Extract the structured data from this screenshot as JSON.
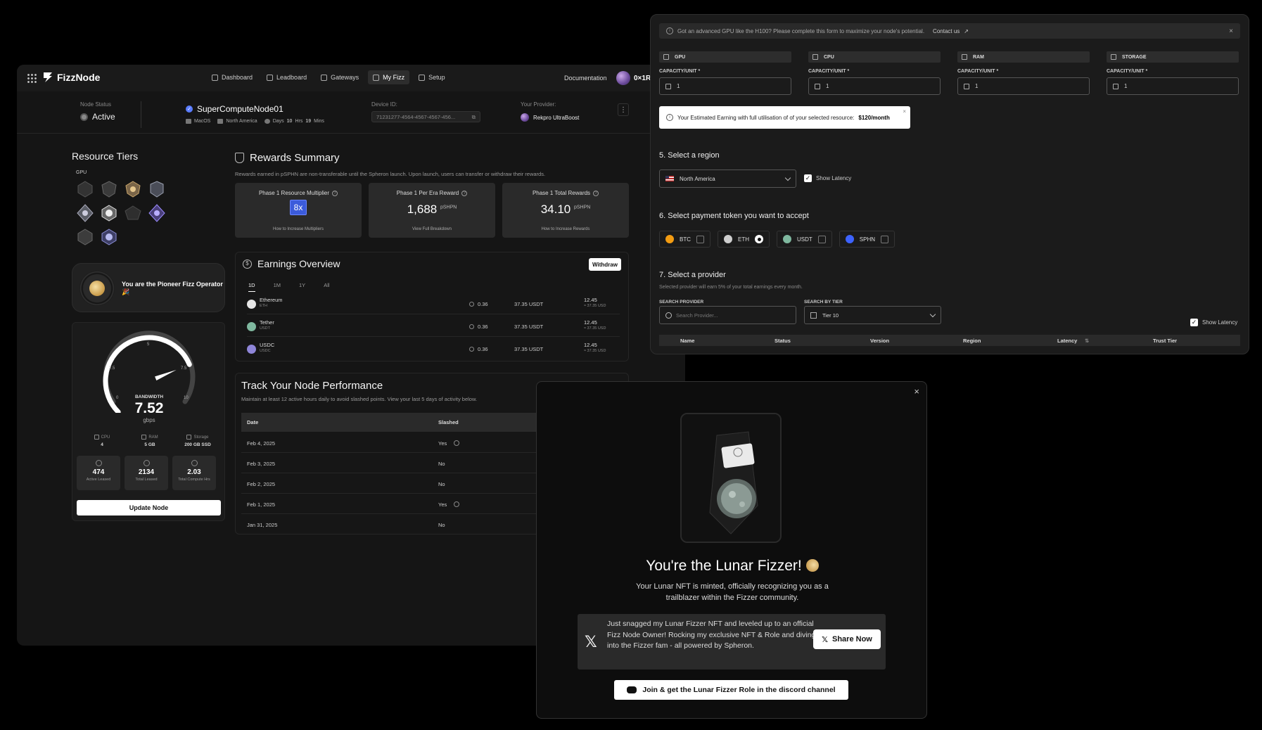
{
  "app": {
    "name": "FizzNode"
  },
  "nav": {
    "items": [
      {
        "label": "Dashboard"
      },
      {
        "label": "Leadboard"
      },
      {
        "label": "Gateways"
      },
      {
        "label": "My Fizz"
      },
      {
        "label": "Setup"
      }
    ],
    "active": "My Fizz",
    "documentation": "Documentation",
    "wallet": "0×1R..."
  },
  "status": {
    "node_status_label": "Node Status",
    "node_status": "Active",
    "node_name": "SuperComputeNode01",
    "os": "MacOS",
    "region": "North America",
    "days_prefix": "Days",
    "days": "10",
    "hrs_word": "Hrs",
    "hrs": "19",
    "mins_word": "Mins",
    "device_label": "Device ID:",
    "device_id": "71231277-4564-4567-4567-456...",
    "provider_label": "Your Provider:",
    "provider": "Rekpro UltraBoost"
  },
  "resource_tiers": {
    "title": "Resource Tiers",
    "gpu_label": "GPU",
    "pioneer_text": "You are the Pioneer Fizz Operator 🎉"
  },
  "gauge": {
    "label": "BANDWIDTH",
    "value": "7.52",
    "unit": "gbps",
    "fill_fraction": 0.75,
    "ticks": [
      "0",
      "2.5",
      "5",
      "7.5",
      "10"
    ]
  },
  "resources": [
    {
      "name": "CPU",
      "value": "4"
    },
    {
      "name": "RAM",
      "value": "5 GB"
    },
    {
      "name": "Storage",
      "value": "200 GB SSD"
    }
  ],
  "stats": [
    {
      "value": "474",
      "label": "Active Leased"
    },
    {
      "value": "2134",
      "label": "Total Leased"
    },
    {
      "value": "2.03",
      "label": "Total Compute Hrs"
    }
  ],
  "update_button": "Update Node",
  "rewards": {
    "title": "Rewards Summary",
    "subtitle": "Rewards earned in pSPHN are non-transferable until the Spheron launch. Upon launch, users can transfer or withdraw their rewards.",
    "cards": [
      {
        "title": "Phase 1 Resource Multiplier",
        "value": "8x",
        "unit": "",
        "link": "How to Increase Multipliers"
      },
      {
        "title": "Phase 1 Per Era Reward",
        "value": "1,688",
        "unit": "pSHPN",
        "link": "View Full Breakdown"
      },
      {
        "title": "Phase 1 Total Rewards",
        "value": "34.10",
        "unit": "pSHPN",
        "link": "How to Increase Rewards"
      }
    ]
  },
  "earnings": {
    "title": "Earnings Overview",
    "withdraw": "Withdraw",
    "tabs": [
      "1D",
      "1M",
      "1Y",
      "All"
    ],
    "rows": [
      {
        "name": "Ethereum",
        "symbol": "ETH",
        "amount": "0.36",
        "usdt": "37.35 USDT",
        "value": "12.45",
        "sub": "≈ 37.35 USD",
        "color": "#e6e6e6"
      },
      {
        "name": "Tether",
        "symbol": "USDT",
        "amount": "0.36",
        "usdt": "37.35 USDT",
        "value": "12.45",
        "sub": "≈ 37.35 USD",
        "color": "#7fb89f"
      },
      {
        "name": "USDC",
        "symbol": "USDC",
        "amount": "0.36",
        "usdt": "37.35 USDT",
        "value": "12.45",
        "sub": "≈ 37.35 USD",
        "color": "#8f86d9"
      }
    ]
  },
  "performance": {
    "title": "Track Your Node Performance",
    "subtitle": "Maintain at least 12 active hours daily to avoid slashed points. View your last 5 days of activity below.",
    "headers": [
      "Date",
      "Slashed"
    ],
    "rows": [
      {
        "date": "Feb 4, 2025",
        "slashed": "Yes"
      },
      {
        "date": "Feb 3, 2025",
        "slashed": "No"
      },
      {
        "date": "Feb 2, 2025",
        "slashed": "No"
      },
      {
        "date": "Feb 1, 2025",
        "slashed": "Yes"
      },
      {
        "date": "Jan 31, 2025",
        "slashed": "No"
      }
    ]
  },
  "config": {
    "info": "Got an advanced GPU like the H100? Please complete this form to maximize your node's potential.",
    "contact": "Contact us",
    "resources": [
      {
        "name": "GPU",
        "cap_label": "CAPACITY/UNIT *",
        "value": "1"
      },
      {
        "name": "CPU",
        "cap_label": "CAPACITY/UNIT *",
        "value": "1"
      },
      {
        "name": "RAM",
        "cap_label": "CAPACITY/UNIT *",
        "value": "1"
      },
      {
        "name": "STORAGE",
        "cap_label": "CAPACITY/UNIT *",
        "value": "1"
      }
    ],
    "estimate_text": "Your Estimated Earning with full utilisation of of your selected resource:",
    "estimate_value": "$120/month",
    "region_title": "5. Select a region",
    "region_value": "North America",
    "show_latency": "Show Latency",
    "token_title": "6. Select payment token you want to accept",
    "tokens": [
      {
        "name": "BTC",
        "color": "#f39c12",
        "selected": false
      },
      {
        "name": "ETH",
        "color": "#cfcfcf",
        "selected": true
      },
      {
        "name": "USDT",
        "color": "#7fb89f",
        "selected": false
      },
      {
        "name": "SPHN",
        "color": "#3d63ff",
        "selected": false
      }
    ],
    "provider_title": "7. Select a provider",
    "provider_sub": "Selected provider will earn 5% of your total earnings every month.",
    "search_label": "SEARCH PROVIDER",
    "search_placeholder": "Search Provider...",
    "tier_label": "SEARCH BY TIER",
    "tier_value": "Tier 10",
    "table_headers": [
      "Name",
      "Status",
      "Version",
      "Region",
      "Latency",
      "Trust Tier"
    ]
  },
  "modal": {
    "title": "You're the Lunar Fizzer!",
    "subtitle_line1": "Your Lunar NFT is minted, officially recognizing you as a",
    "subtitle_line2": "trailblazer within the Fizzer community.",
    "tweet": "Just snagged my Lunar Fizzer NFT and leveled up to an official Fizz Node Owner! Rocking my exclusive NFT & Role and diving into the Fizzer fam - all powered by Spheron.",
    "share": "Share Now",
    "discord": "Join & get the Lunar Fizzer Role in the discord channel"
  }
}
